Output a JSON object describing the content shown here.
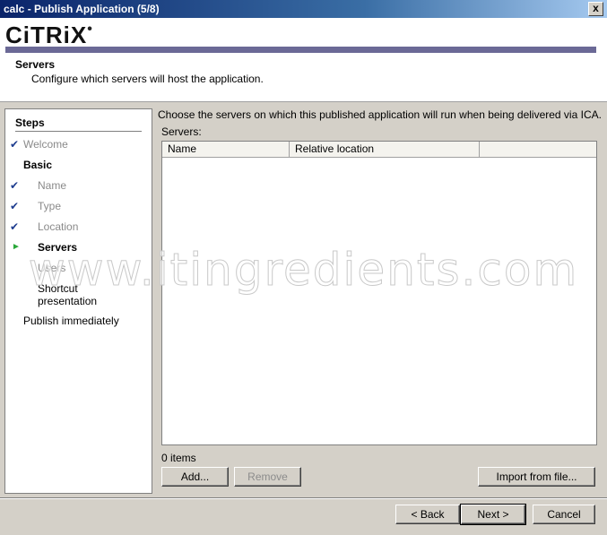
{
  "window": {
    "title": "calc - Publish Application (5/8)",
    "close_glyph": "x"
  },
  "header": {
    "logo_text": "CiTRiX",
    "logo_mark": "•",
    "title": "Servers",
    "subtitle": "Configure which servers will host the application."
  },
  "steps": {
    "title": "Steps",
    "items": [
      {
        "label": "Welcome",
        "state": "done"
      },
      {
        "label": "Basic",
        "state": "section"
      },
      {
        "label": "Name",
        "state": "done"
      },
      {
        "label": "Type",
        "state": "done"
      },
      {
        "label": "Location",
        "state": "done"
      },
      {
        "label": "Servers",
        "state": "current"
      },
      {
        "label": "Users",
        "state": "pending"
      },
      {
        "label": "Shortcut",
        "state": "pending"
      },
      {
        "label": "presentation",
        "state": "pending"
      },
      {
        "label": "Publish immediately",
        "state": "section"
      }
    ],
    "check_glyph": "✔",
    "arrow_glyph": "►"
  },
  "main": {
    "description": "Choose the servers on which this published application will run when being delivered via ICA.",
    "servers_label": "Servers:",
    "columns": [
      "Name",
      "Relative location"
    ],
    "count_text": "0 items",
    "add_label": "Add...",
    "remove_label": "Remove",
    "import_label": "Import from file..."
  },
  "watermark": "www.itingredients.com",
  "footer": {
    "back_label": "< Back",
    "next_label": "Next >",
    "cancel_label": "Cancel"
  },
  "colors": {
    "accent_bar": "#6b6996",
    "title_bar": "#0a246a",
    "check": "#1f3d8f",
    "current_arrow": "#2aa83a"
  }
}
